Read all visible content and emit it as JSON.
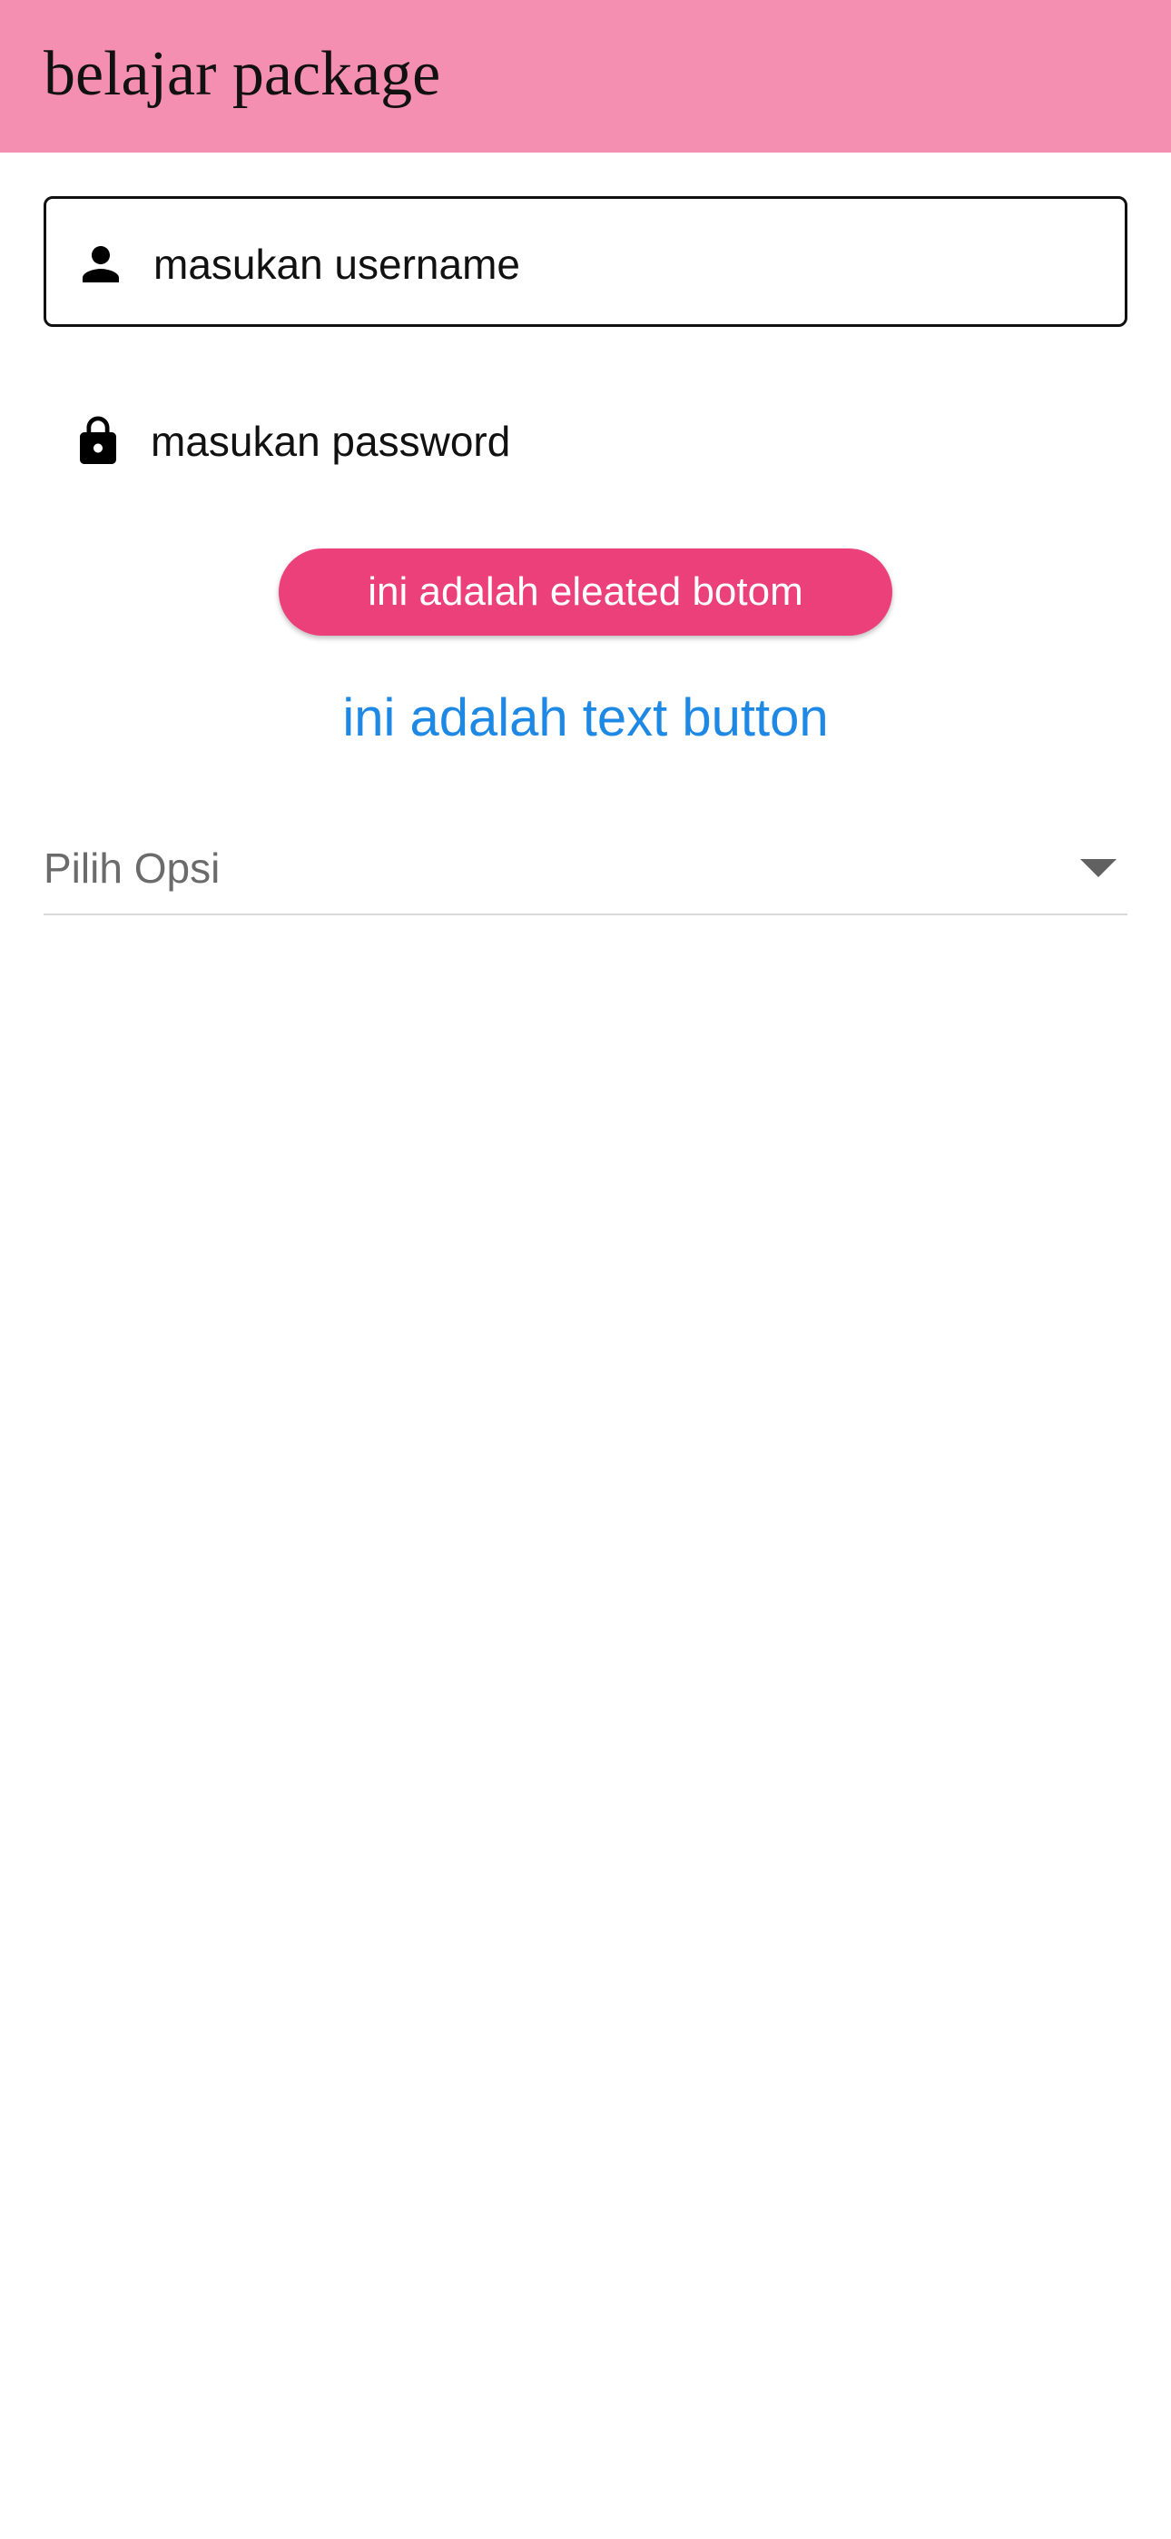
{
  "app_bar": {
    "title": "belajar package",
    "background_color": "#f48fb1"
  },
  "form": {
    "username": {
      "placeholder": "masukan username",
      "icon": "person-icon"
    },
    "password": {
      "placeholder": "masukan password",
      "icon": "lock-icon"
    }
  },
  "buttons": {
    "elevated_label": "ini adalah eleated botom",
    "elevated_color": "#ec407a",
    "text_label": "ini adalah text button",
    "text_color": "#1e88e5"
  },
  "dropdown": {
    "hint": "Pilih Opsi",
    "icon": "arrow-drop-down-icon"
  }
}
